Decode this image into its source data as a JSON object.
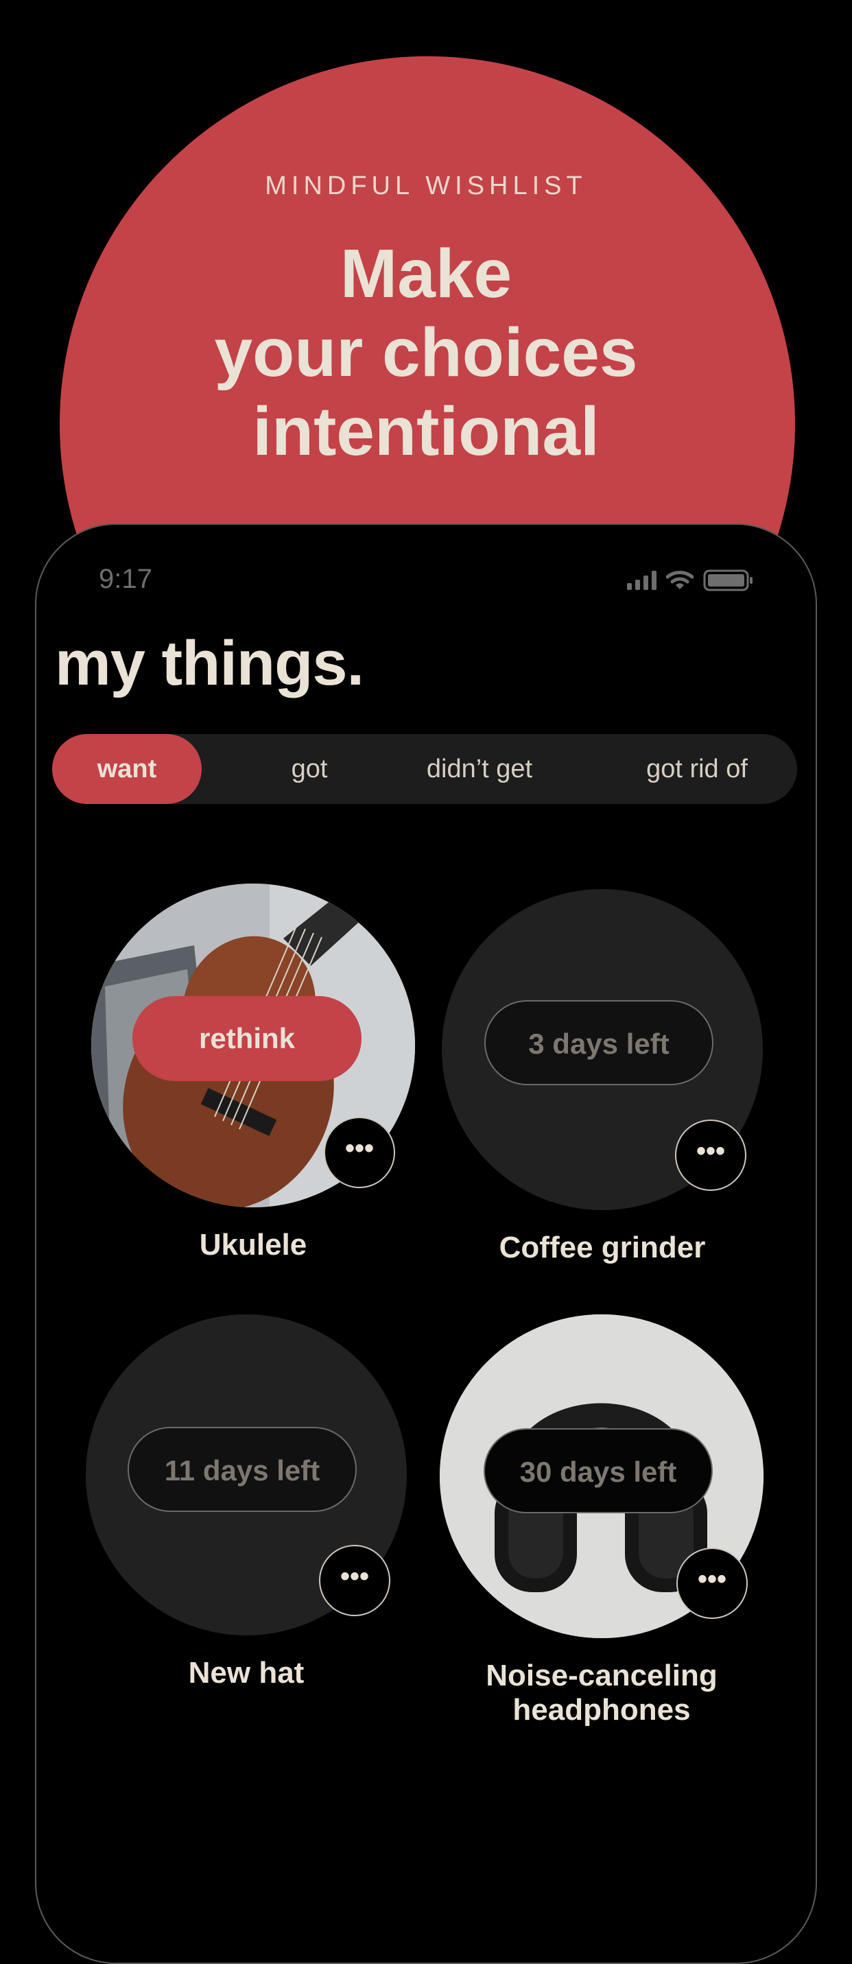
{
  "hero": {
    "eyebrow": "MINDFUL WISHLIST",
    "headline_lines": [
      "Make",
      "your choices",
      "intentional"
    ]
  },
  "status_bar": {
    "time": "9:17",
    "icons": [
      "signal-icon",
      "wifi-icon",
      "battery-icon"
    ]
  },
  "screen": {
    "title": "my things."
  },
  "tabs": [
    {
      "label": "want",
      "active": true
    },
    {
      "label": "got",
      "active": false
    },
    {
      "label": "didn’t get",
      "active": false
    },
    {
      "label": "got rid of",
      "active": false
    }
  ],
  "items": [
    {
      "name": "Ukulele",
      "status": "rethink",
      "image": "ukulele-photo",
      "more": "•••"
    },
    {
      "name": "Coffee grinder",
      "status": "3 days left",
      "image": null,
      "more": "•••"
    },
    {
      "name": "New hat",
      "status": "11 days left",
      "image": null,
      "more": "•••"
    },
    {
      "name": "Noise-canceling headphones",
      "name_lines": [
        "Noise-canceling",
        "headphones"
      ],
      "status": "30 days left",
      "image": "headphones-photo",
      "more": "•••"
    }
  ],
  "colors": {
    "accent": "#c34348",
    "text": "#ebe2d6",
    "background": "#000000",
    "card": "#212121"
  }
}
